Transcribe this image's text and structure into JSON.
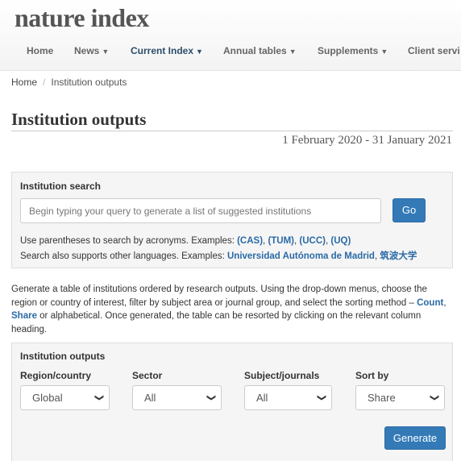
{
  "logo": "nature index",
  "nav": [
    {
      "label": "Home",
      "has_caret": false
    },
    {
      "label": "News",
      "has_caret": true
    },
    {
      "label": "Current Index",
      "has_caret": true
    },
    {
      "label": "Annual tables",
      "has_caret": true
    },
    {
      "label": "Supplements",
      "has_caret": true
    },
    {
      "label": "Client servi",
      "has_caret": false
    }
  ],
  "active_nav": "Current Index",
  "breadcrumb": {
    "home": "Home",
    "separator": "/",
    "current": "Institution outputs"
  },
  "page_title": "Institution outputs",
  "date_range": "1 February 2020 - 31 January 2021",
  "search": {
    "label": "Institution search",
    "placeholder": "Begin typing your query to generate a list of suggested institutions",
    "go_label": "Go",
    "help1_text": "Use parentheses to search by acronyms. Examples: ",
    "help1_examples": [
      "(CAS)",
      "(TUM)",
      "(UCC)",
      "(UQ)"
    ],
    "help2_text": "Search also supports other languages. Examples: ",
    "help2_examples": [
      "Universidad Autónoma de Madrid",
      "筑波大学"
    ]
  },
  "intro": {
    "part1": "Generate a table of institutions ordered by research outputs. Using the drop-down menus, choose the region or country of interest, filter by subject area or journal group, and select the sorting method – ",
    "count": "Count",
    "comma": ", ",
    "share": "Share",
    "part2": " or alphabetical. Once generated, the table can be resorted by clicking on the relevant column heading."
  },
  "outputs": {
    "label": "Institution outputs",
    "fields": [
      {
        "label": "Region/country",
        "value": "Global"
      },
      {
        "label": "Sector",
        "value": "All"
      },
      {
        "label": "Subject/journals",
        "value": "All"
      },
      {
        "label": "Sort by",
        "value": "Share"
      }
    ],
    "generate_label": "Generate"
  },
  "colors": {
    "accent": "#337ab7",
    "link": "#2a6aa6",
    "nav_active": "#2c4e6b"
  },
  "icons": {
    "dropdown_caret": "caret-down-icon",
    "select_chevron": "chevron-down-icon"
  }
}
